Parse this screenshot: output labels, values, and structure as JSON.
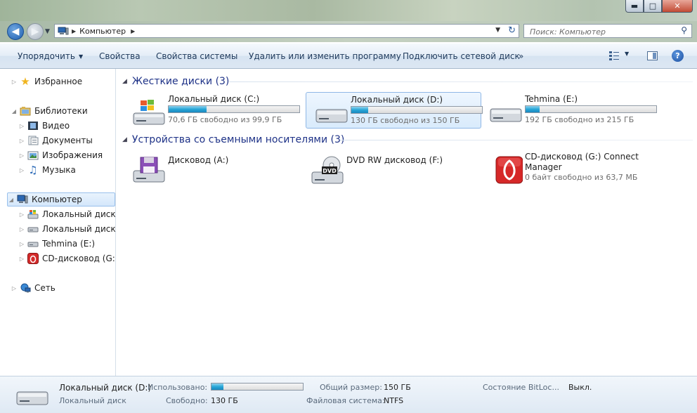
{
  "window": {
    "minimize": "▬",
    "maximize": "□",
    "close": "✕"
  },
  "nav": {
    "back_icon": "back-arrow-icon",
    "forward_icon": "forward-arrow-icon",
    "address_crumb": "Компьютер",
    "search_placeholder": "Поиск: Компьютер"
  },
  "toolbar": {
    "organize": "Упорядочить",
    "properties": "Свойства",
    "system_properties": "Свойства системы",
    "uninstall": "Удалить или изменить программу",
    "map_drive": "Подключить сетевой диск",
    "more": "»"
  },
  "sidebar": {
    "favorites": "Избранное",
    "libraries": "Библиотеки",
    "video": "Видео",
    "documents": "Документы",
    "images": "Изображения",
    "music": "Музыка",
    "computer": "Компьютер",
    "disk_c": "Локальный диск (C:)",
    "disk_d": "Локальный диск (D:)",
    "disk_e": "Tehmina (E:)",
    "disk_g": "CD-дисковод (G:) Connect Manager",
    "network": "Сеть"
  },
  "groups": {
    "hard_disks": "Жесткие диски (3)",
    "removable": "Устройства со съемными носителями (3)"
  },
  "drives": {
    "c": {
      "name": "Локальный диск (C:)",
      "free": "70,6 ГБ свободно из 99,9 ГБ",
      "used_fraction": 0.29
    },
    "d": {
      "name": "Локальный диск (D:)",
      "free": "130 ГБ свободно из 150 ГБ",
      "used_fraction": 0.13
    },
    "e": {
      "name": "Tehmina (E:)",
      "free": "192 ГБ свободно из 215 ГБ",
      "used_fraction": 0.11
    }
  },
  "devices": {
    "a": {
      "name": "Дисковод (A:)"
    },
    "f": {
      "name": "DVD RW дисковод (F:)",
      "badge": "DVD"
    },
    "g": {
      "name_line1": "CD-дисковод (G:) Connect",
      "name_line2": "Manager",
      "free": "0 байт свободно из 63,7 МБ"
    }
  },
  "details": {
    "name": "Локальный диск (D:)",
    "type": "Локальный диск",
    "used_label": "Использовано:",
    "used_fraction": 0.13,
    "free_label": "Свободно:",
    "free_value": "130 ГБ",
    "total_label": "Общий размер:",
    "total_value": "150 ГБ",
    "fs_label": "Файловая система:",
    "fs_value": "NTFS",
    "bitlocker_label": "Состояние BitLoc...",
    "bitlocker_value": "Выкл."
  },
  "colors": {
    "accent": "#1e3287",
    "bar_fill": "#28a7d8",
    "toolbar_text": "#1e395b"
  }
}
